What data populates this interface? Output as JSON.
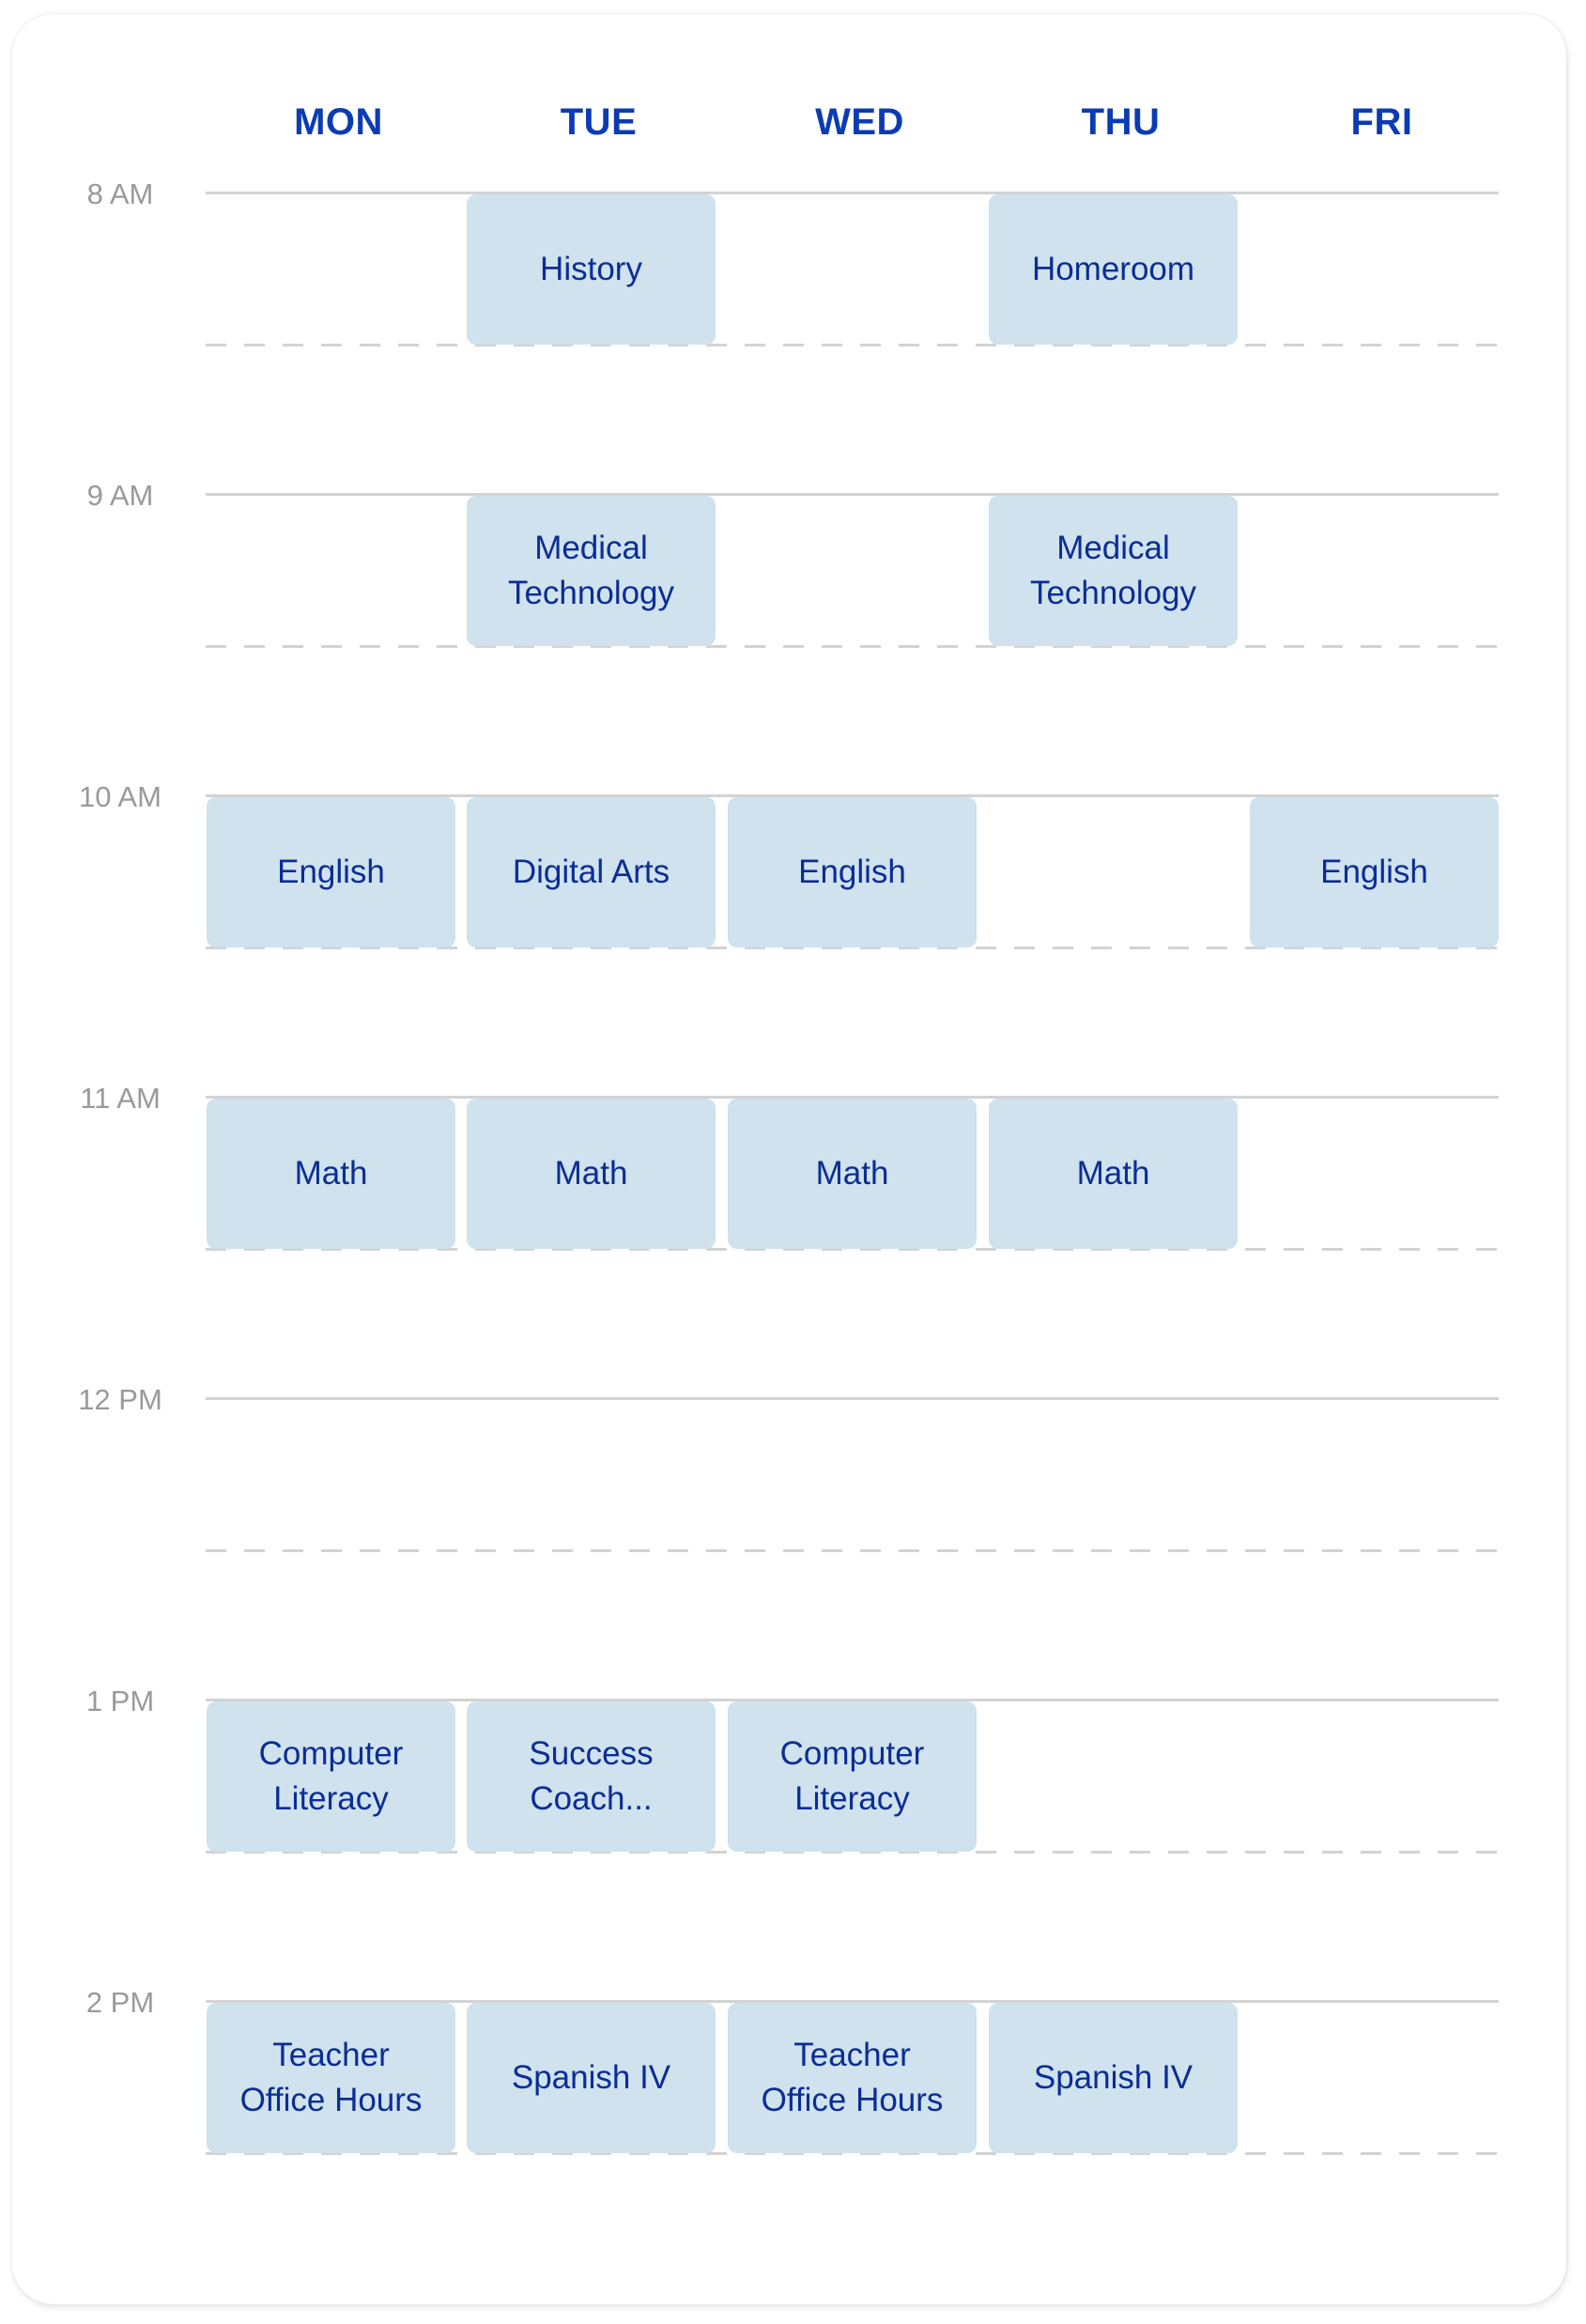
{
  "schedule": {
    "days": [
      "MON",
      "TUE",
      "WED",
      "THU",
      "FRI"
    ],
    "times": [
      "8 AM",
      "9 AM",
      "10 AM",
      "11 AM",
      "12 PM",
      "1 PM",
      "2 PM"
    ],
    "colors": {
      "day_header": "#0b3bb5",
      "block_bg": "#cfe2ed",
      "block_text": "#0a2d95",
      "time_label": "#9a9a9a",
      "grid_line": "#d3d3d3"
    },
    "classes": [
      {
        "day": 1,
        "time": 0,
        "label": "History"
      },
      {
        "day": 3,
        "time": 0,
        "label": "Homeroom"
      },
      {
        "day": 1,
        "time": 1,
        "label": "Medical\nTechnology"
      },
      {
        "day": 3,
        "time": 1,
        "label": "Medical\nTechnology"
      },
      {
        "day": 0,
        "time": 2,
        "label": "English"
      },
      {
        "day": 1,
        "time": 2,
        "label": "Digital Arts"
      },
      {
        "day": 2,
        "time": 2,
        "label": "English"
      },
      {
        "day": 4,
        "time": 2,
        "label": "English"
      },
      {
        "day": 0,
        "time": 3,
        "label": "Math"
      },
      {
        "day": 1,
        "time": 3,
        "label": "Math"
      },
      {
        "day": 2,
        "time": 3,
        "label": "Math"
      },
      {
        "day": 3,
        "time": 3,
        "label": "Math"
      },
      {
        "day": 0,
        "time": 5,
        "label": "Computer\nLiteracy"
      },
      {
        "day": 1,
        "time": 5,
        "label": "Success\nCoach..."
      },
      {
        "day": 2,
        "time": 5,
        "label": "Computer\nLiteracy"
      },
      {
        "day": 0,
        "time": 6,
        "label": "Teacher\nOffice Hours"
      },
      {
        "day": 1,
        "time": 6,
        "label": "Spanish IV"
      },
      {
        "day": 2,
        "time": 6,
        "label": "Teacher\nOffice Hours"
      },
      {
        "day": 3,
        "time": 6,
        "label": "Spanish IV"
      }
    ]
  }
}
